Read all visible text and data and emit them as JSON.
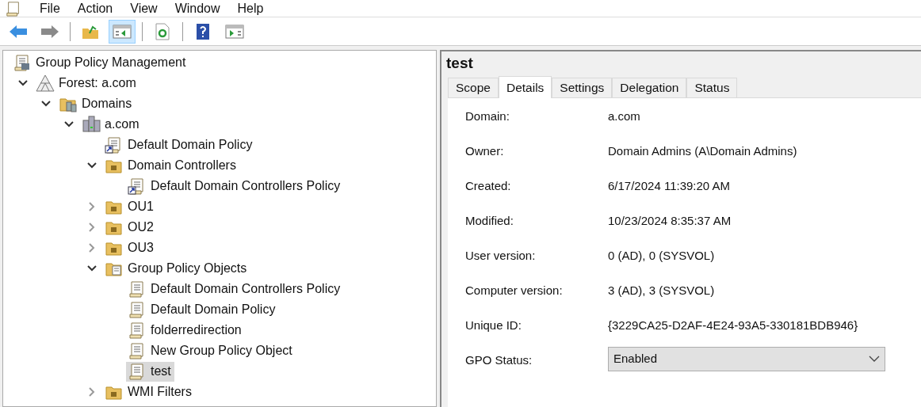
{
  "menu_bar": [
    "File",
    "Action",
    "View",
    "Window",
    "Help"
  ],
  "toolbar": [
    {
      "kind": "back",
      "pressed": false
    },
    {
      "kind": "forward",
      "pressed": false
    },
    {
      "kind": "separator"
    },
    {
      "kind": "up",
      "pressed": false
    },
    {
      "kind": "tree",
      "pressed": true
    },
    {
      "kind": "separator"
    },
    {
      "kind": "refresh",
      "pressed": false
    },
    {
      "kind": "separator"
    },
    {
      "kind": "help",
      "pressed": false
    },
    {
      "kind": "pane",
      "pressed": false
    }
  ],
  "tree": [
    {
      "label": "Group Policy Management",
      "kind": "root",
      "selected": false,
      "children": [
        {
          "label": "Forest: a.com",
          "kind": "forest",
          "expanded": true,
          "selected": false,
          "children": [
            {
              "label": "Domains",
              "kind": "domains",
              "expanded": true,
              "selected": false,
              "children": [
                {
                  "label": "a.com",
                  "kind": "domain",
                  "expanded": true,
                  "selected": false,
                  "children": [
                    {
                      "label": "Default Domain Policy",
                      "kind": "gpo-link",
                      "selected": false
                    },
                    {
                      "label": "Domain Controllers",
                      "kind": "ou",
                      "expanded": true,
                      "selected": false,
                      "children": [
                        {
                          "label": "Default Domain Controllers Policy",
                          "kind": "gpo-link",
                          "selected": false
                        }
                      ]
                    },
                    {
                      "label": "OU1",
                      "kind": "ou",
                      "expanded": false,
                      "selected": false
                    },
                    {
                      "label": "OU2",
                      "kind": "ou",
                      "expanded": false,
                      "selected": false
                    },
                    {
                      "label": "OU3",
                      "kind": "ou",
                      "expanded": false,
                      "selected": false
                    },
                    {
                      "label": "Group Policy Objects",
                      "kind": "gpo-folder",
                      "expanded": true,
                      "selected": false,
                      "children": [
                        {
                          "label": "Default Domain Controllers Policy",
                          "kind": "gpo",
                          "selected": false
                        },
                        {
                          "label": "Default Domain Policy",
                          "kind": "gpo",
                          "selected": false
                        },
                        {
                          "label": "folderredirection",
                          "kind": "gpo",
                          "selected": false
                        },
                        {
                          "label": "New Group Policy Object",
                          "kind": "gpo",
                          "selected": false
                        },
                        {
                          "label": "test",
                          "kind": "gpo",
                          "selected": true
                        }
                      ]
                    },
                    {
                      "label": "WMI Filters",
                      "kind": "ou",
                      "expanded": false,
                      "selected": false
                    }
                  ]
                }
              ]
            }
          ]
        }
      ]
    }
  ],
  "details": {
    "title": "test",
    "tabs": [
      {
        "label": "Scope",
        "selected": false
      },
      {
        "label": "Details",
        "selected": true
      },
      {
        "label": "Settings",
        "selected": false
      },
      {
        "label": "Delegation",
        "selected": false
      },
      {
        "label": "Status",
        "selected": false
      }
    ],
    "fields": [
      {
        "label": "Domain:",
        "value": "a.com"
      },
      {
        "label": "Owner:",
        "value": "Domain Admins (A\\Domain Admins)"
      },
      {
        "label": "Created:",
        "value": "6/17/2024 11:39:20 AM"
      },
      {
        "label": "Modified:",
        "value": "10/23/2024 8:35:37 AM"
      },
      {
        "label": "User version:",
        "value": "0 (AD), 0 (SYSVOL)"
      },
      {
        "label": "Computer version:",
        "value": "3 (AD), 3 (SYSVOL)"
      },
      {
        "label": "Unique ID:",
        "value": "{3229CA25-D2AF-4E24-93A5-330181BDB946}"
      }
    ],
    "gpo_status": {
      "label": "GPO Status:",
      "value": "Enabled"
    }
  }
}
